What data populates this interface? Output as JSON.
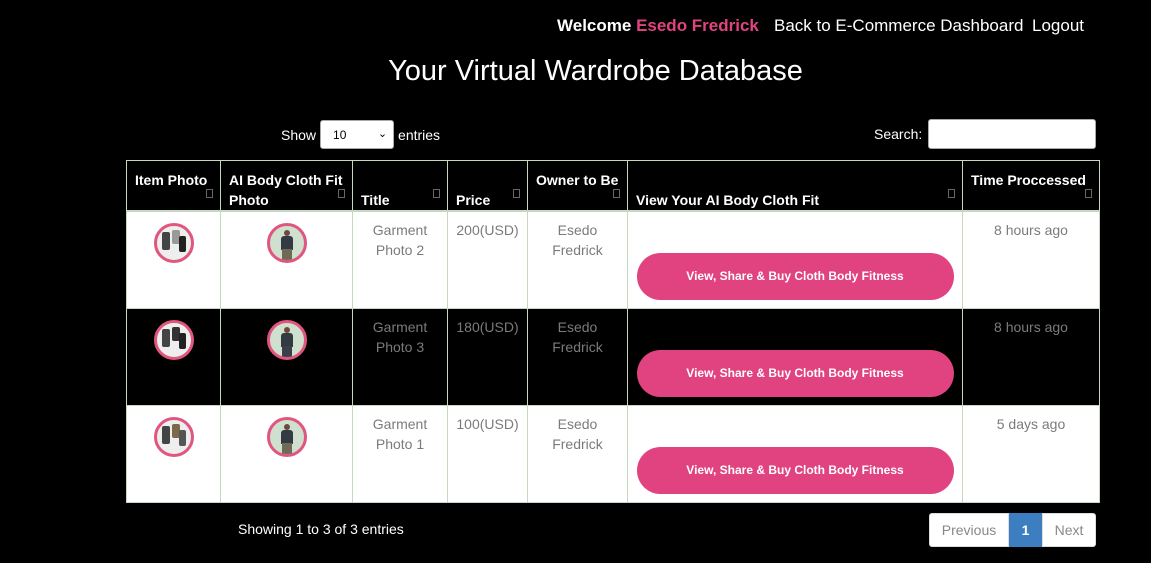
{
  "nav": {
    "welcome_prefix": "Welcome",
    "user_name": "Esedo Fredrick",
    "dashboard_link": "Back to E-Commerce Dashboard",
    "logout_link": "Logout"
  },
  "page_title": "Your Virtual Wardrobe Database",
  "controls": {
    "show_label": "Show",
    "entries_label": "entries",
    "page_size": "10",
    "search_label": "Search:",
    "search_value": ""
  },
  "table": {
    "headers": [
      "Item Photo",
      "AI Body Cloth Fit Photo",
      "Title",
      "Price",
      "Owner to Be",
      "View Your AI Body Cloth Fit",
      "Time Proccessed"
    ],
    "rows": [
      {
        "title": "Garment Photo 2",
        "price": "200(USD)",
        "owner": "Esedo Fredrick",
        "action": "View, Share & Buy Cloth Body Fitness",
        "time": "8 hours ago"
      },
      {
        "title": "Garment Photo 3",
        "price": "180(USD)",
        "owner": "Esedo Fredrick",
        "action": "View, Share & Buy Cloth Body Fitness",
        "time": "8 hours ago"
      },
      {
        "title": "Garment Photo 1",
        "price": "100(USD)",
        "owner": "Esedo Fredrick",
        "action": "View, Share & Buy Cloth Body Fitness",
        "time": "5 days ago"
      }
    ]
  },
  "footer": {
    "info": "Showing 1 to 3 of 3 entries",
    "previous": "Previous",
    "current_page": "1",
    "next": "Next"
  },
  "colors": {
    "accent": "#e0437f",
    "pager_active": "#3c7ec0",
    "background": "#000000"
  }
}
